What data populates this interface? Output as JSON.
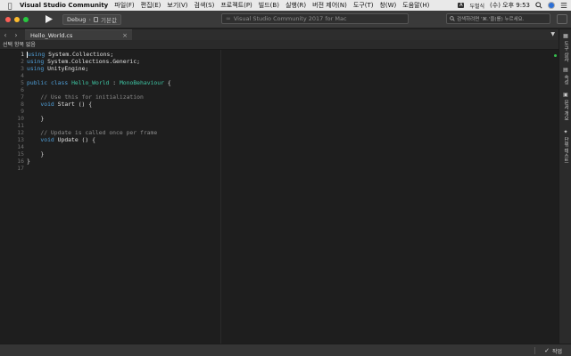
{
  "menubar": {
    "app_name": "Visual Studio Community",
    "items": [
      "파일(F)",
      "편집(E)",
      "보기(V)",
      "검색(S)",
      "프로젝트(P)",
      "빌드(B)",
      "실행(R)",
      "버전 제어(N)",
      "도구(T)",
      "창(W)",
      "도움말(H)"
    ],
    "ime_label": "두벌식",
    "clock": "(수) 오후 9:53"
  },
  "toolbar": {
    "config": "Debug",
    "device": "기본값",
    "title": "Visual Studio Community 2017 for Mac",
    "search_placeholder": "검색하려면 '⌘.'을(를) 누르세요."
  },
  "tabs": [
    {
      "label": "Hello_World.cs",
      "active": true
    }
  ],
  "pathbar": {
    "text": "선택 항목 없음"
  },
  "editor": {
    "current_line": 1,
    "lines": [
      [
        {
          "t": "using",
          "c": "kw"
        },
        {
          "t": " System.Collections;",
          "c": "tx"
        }
      ],
      [
        {
          "t": "using",
          "c": "kw"
        },
        {
          "t": " System.Collections.Generic;",
          "c": "tx"
        }
      ],
      [
        {
          "t": "using",
          "c": "kw"
        },
        {
          "t": " UnityEngine;",
          "c": "tx"
        }
      ],
      [],
      [
        {
          "t": "public",
          "c": "kw"
        },
        {
          "t": " ",
          "c": "tx"
        },
        {
          "t": "class",
          "c": "kw"
        },
        {
          "t": " ",
          "c": "tx"
        },
        {
          "t": "Hello_World",
          "c": "cls"
        },
        {
          "t": " : ",
          "c": "tx"
        },
        {
          "t": "MonoBehaviour",
          "c": "cls"
        },
        {
          "t": " {",
          "c": "tx"
        }
      ],
      [],
      [
        {
          "t": "    // Use this for initialization",
          "c": "cm"
        }
      ],
      [
        {
          "t": "    ",
          "c": "tx"
        },
        {
          "t": "void",
          "c": "kw"
        },
        {
          "t": " Start () {",
          "c": "tx"
        }
      ],
      [],
      [
        {
          "t": "    }",
          "c": "tx"
        }
      ],
      [],
      [
        {
          "t": "    // Update is called once per frame",
          "c": "cm"
        }
      ],
      [
        {
          "t": "    ",
          "c": "tx"
        },
        {
          "t": "void",
          "c": "kw"
        },
        {
          "t": " Update () {",
          "c": "tx"
        }
      ],
      [],
      [
        {
          "t": "    }",
          "c": "tx"
        }
      ],
      [
        {
          "t": "}",
          "c": "tx"
        }
      ],
      []
    ]
  },
  "right_panel": [
    {
      "icon": "toolbox-icon",
      "label": "도구 상자"
    },
    {
      "icon": "properties-icon",
      "label": "속성"
    },
    {
      "icon": "document-outline-icon",
      "label": "문서 개요"
    },
    {
      "icon": "unit-tests-icon",
      "label": "단위 테스트"
    }
  ],
  "status": {
    "task_label": "작업"
  },
  "colors": {
    "keyword": "#4f9fd8",
    "type": "#3ec5a3",
    "comment": "#8c8c8c",
    "background": "#1e1e1e"
  }
}
